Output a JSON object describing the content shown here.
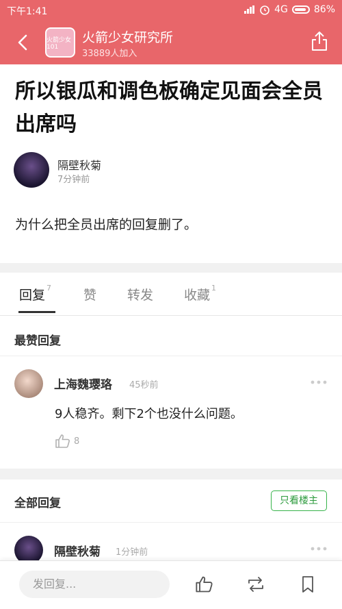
{
  "status_bar": {
    "time": "下午1:41",
    "network": "4G",
    "battery": "86%"
  },
  "group": {
    "name": "火箭少女研究所",
    "members": "33889人加入",
    "logo_text": "火箭少女101"
  },
  "post": {
    "title": "所以银瓜和调色板确定见面会全员出席吗",
    "author": "隔壁秋菊",
    "time": "7分钟前",
    "content": "为什么把全员出席的回复删了。"
  },
  "tabs": [
    {
      "label": "回复",
      "count": "7"
    },
    {
      "label": "赞",
      "count": ""
    },
    {
      "label": "转发",
      "count": ""
    },
    {
      "label": "收藏",
      "count": "1"
    }
  ],
  "top_replies": {
    "title": "最赞回复",
    "items": [
      {
        "name": "上海魏璎珞",
        "time": "45秒前",
        "text": "9人稳齐。剩下2个也没什么问题。",
        "likes": "8"
      }
    ]
  },
  "all_replies": {
    "title": "全部回复",
    "op_only_label": "只看楼主",
    "items": [
      {
        "name": "隔壁秋菊",
        "time": "1分钟前"
      }
    ]
  },
  "bottom_bar": {
    "reply_placeholder": "发回复..."
  },
  "colors": {
    "header": "#e8666a",
    "op_button": "#36b34a"
  }
}
